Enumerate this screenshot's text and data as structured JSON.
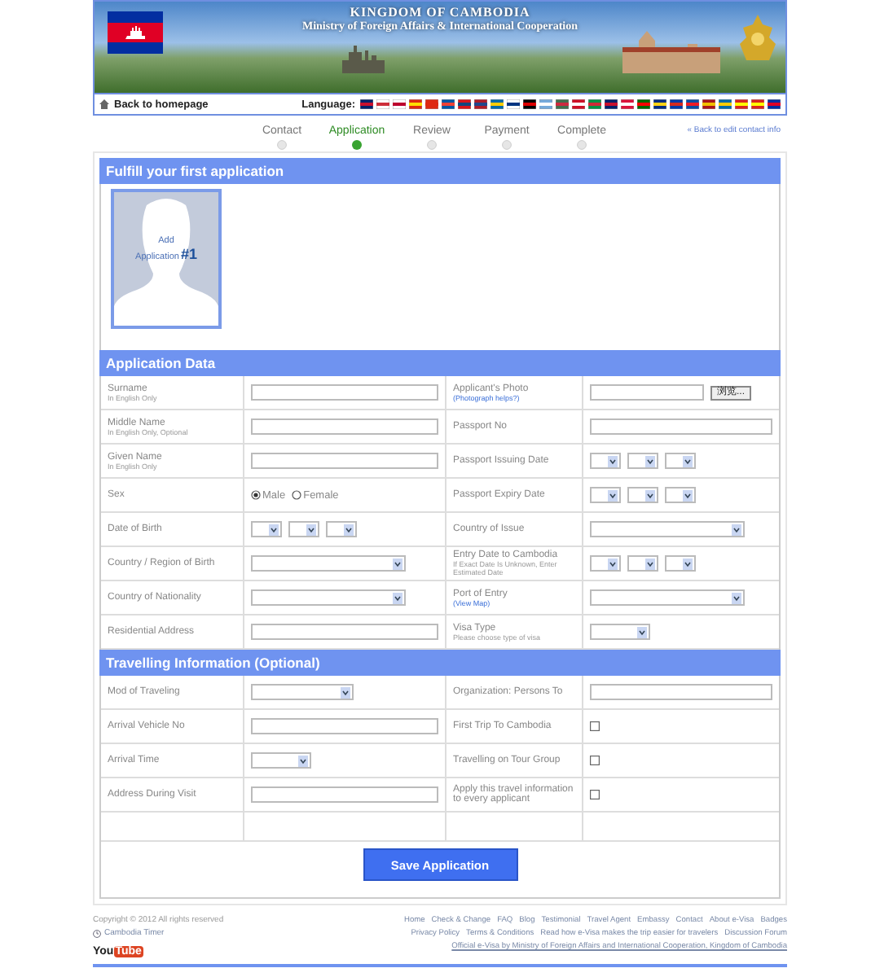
{
  "header": {
    "title": "KINGDOM OF CAMBODIA",
    "subtitle": "Ministry of Foreign Affairs & International Cooperation",
    "back_link": "Back to homepage",
    "language_label": "Language:"
  },
  "steps": [
    {
      "label": "Contact",
      "selected": false
    },
    {
      "label": "Application",
      "selected": true
    },
    {
      "label": "Review",
      "selected": false
    },
    {
      "label": "Payment",
      "selected": false
    },
    {
      "label": "Complete",
      "selected": false
    }
  ],
  "back_contact": "« Back to edit contact info",
  "first_application": {
    "title": "Fulfill your first application",
    "add_line1": "Add",
    "add_line2": "Application",
    "add_number": "#1"
  },
  "application_data": {
    "title": "Application Data",
    "rows": [
      {
        "cells": [
          {
            "label": "Surname",
            "hint": "In English Only",
            "kind": "text"
          },
          {
            "label": "Applicant's Photo",
            "link": "(Photograph helps?)",
            "kind": "file",
            "button": "浏览..."
          }
        ]
      },
      {
        "cells": [
          {
            "label": "Middle Name",
            "hint": "In English Only, Optional",
            "kind": "text"
          },
          {
            "label": "Passport No",
            "kind": "text"
          }
        ]
      },
      {
        "cells": [
          {
            "label": "Given Name",
            "hint": "In English Only",
            "kind": "text"
          },
          {
            "label": "Passport Issuing Date",
            "kind": "date"
          }
        ]
      },
      {
        "cells": [
          {
            "label": "Sex",
            "kind": "radio",
            "options": [
              {
                "label": "Male",
                "selected": true
              },
              {
                "label": "Female",
                "selected": false
              }
            ]
          },
          {
            "label": "Passport Expiry Date",
            "kind": "date"
          }
        ]
      },
      {
        "cells": [
          {
            "label": "Date of Birth",
            "kind": "date"
          },
          {
            "label": "Country of Issue",
            "kind": "select-wide"
          }
        ]
      },
      {
        "cells": [
          {
            "label": "Country / Region of Birth",
            "kind": "select-wide"
          },
          {
            "label": "Entry Date to Cambodia",
            "hint": "If Exact Date Is Unknown, Enter Estimated Date",
            "kind": "date"
          }
        ]
      },
      {
        "cells": [
          {
            "label": "Country of Nationality",
            "kind": "select-wide"
          },
          {
            "label": "Port of Entry",
            "link": "(View Map)",
            "kind": "select-wide"
          }
        ]
      },
      {
        "cells": [
          {
            "label": "Residential Address",
            "kind": "text"
          },
          {
            "label": "Visa Type",
            "hint": "Please choose type of visa",
            "kind": "select-small"
          }
        ]
      }
    ]
  },
  "travelling": {
    "title": "Travelling Information (Optional)",
    "rows": [
      {
        "cells": [
          {
            "label": "Mod of Traveling",
            "kind": "select-mid"
          },
          {
            "label": "Organization: Persons To",
            "kind": "text"
          }
        ]
      },
      {
        "cells": [
          {
            "label": "Arrival Vehicle No",
            "kind": "text"
          },
          {
            "label": "First Trip To Cambodia",
            "kind": "checkbox",
            "checked": false
          }
        ]
      },
      {
        "cells": [
          {
            "label": "Arrival Time",
            "kind": "select-small"
          },
          {
            "label": "Travelling on Tour Group",
            "kind": "checkbox",
            "checked": false
          }
        ]
      },
      {
        "cells": [
          {
            "label": "Address During Visit",
            "kind": "text"
          },
          {
            "label": "Apply this travel information to every applicant",
            "kind": "checkbox",
            "checked": false
          }
        ]
      }
    ]
  },
  "save_button": "Save Application",
  "footer": {
    "copyright": "Copyright © 2012  All rights reserved",
    "timer": "Cambodia Timer",
    "youtube_you": "You",
    "youtube_tube": "Tube",
    "links": [
      "Home",
      "Check & Change",
      "FAQ",
      "Blog",
      "Testimonial",
      "Travel Agent",
      "Embassy",
      "Contact",
      "About e-Visa",
      "Badges"
    ],
    "links2": [
      "Privacy Policy",
      "Terms & Conditions",
      "Read how e-Visa makes the trip easier for travelers",
      "Discussion Forum"
    ],
    "official": "Official e-Visa by Ministry of Foreign Affairs and International Cooperation, Kingdom of Cambodia"
  }
}
